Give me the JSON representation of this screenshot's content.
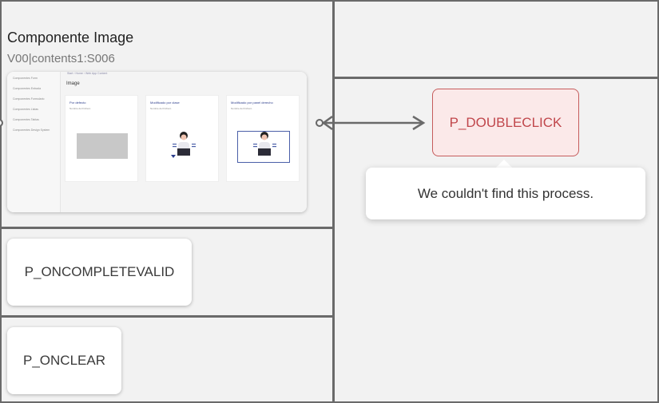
{
  "screen": {
    "title": "Componente Image",
    "id": "V00|contents1:S006"
  },
  "thumbnail": {
    "sidebar": [
      "Componentes Form",
      "Componentes Entrada",
      "Componentes Formulario",
      "Componentes Listas",
      "Componentes Tablas",
      "Componentes Design System"
    ],
    "breadcrumb": "Start  ›  Home  ›  Web App Content",
    "heading": "Image",
    "cards": [
      {
        "title": "Por defecto",
        "subtitle": "Nombre del Fichero"
      },
      {
        "title": "Modificado por clase",
        "subtitle": "Nombre del Fichero"
      },
      {
        "title": "Modificado por panel derecho",
        "subtitle": "Nombre del Fichero"
      }
    ]
  },
  "nodes": {
    "oncompletevalid": "P_ONCOMPLETEVALID",
    "onclear": "P_ONCLEAR",
    "doubleclick": "P_DOUBLECLICK"
  },
  "tooltip": {
    "message": "We couldn't find this process."
  },
  "colors": {
    "error_bg": "#fbe9e9",
    "error_border": "#c65c5c",
    "error_text": "#c0464b",
    "divider": "#6a6a6a"
  }
}
